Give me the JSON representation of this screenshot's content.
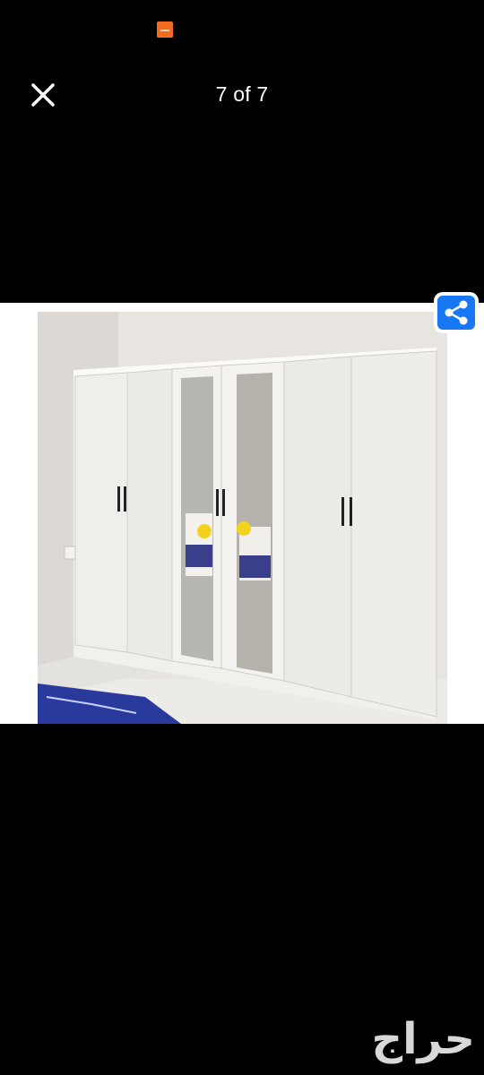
{
  "status_bar": {
    "notification_icon": "harag-app-icon"
  },
  "viewer": {
    "counter": "7 of 7",
    "close_icon": "close-icon",
    "share_icon": "share-icon"
  },
  "photo": {
    "subject_icon": "wardrobe-photo"
  },
  "watermark": {
    "text": "حراج"
  },
  "colors": {
    "background": "#000000",
    "share_button": "#1877f2",
    "status_icon": "#f26b21"
  }
}
